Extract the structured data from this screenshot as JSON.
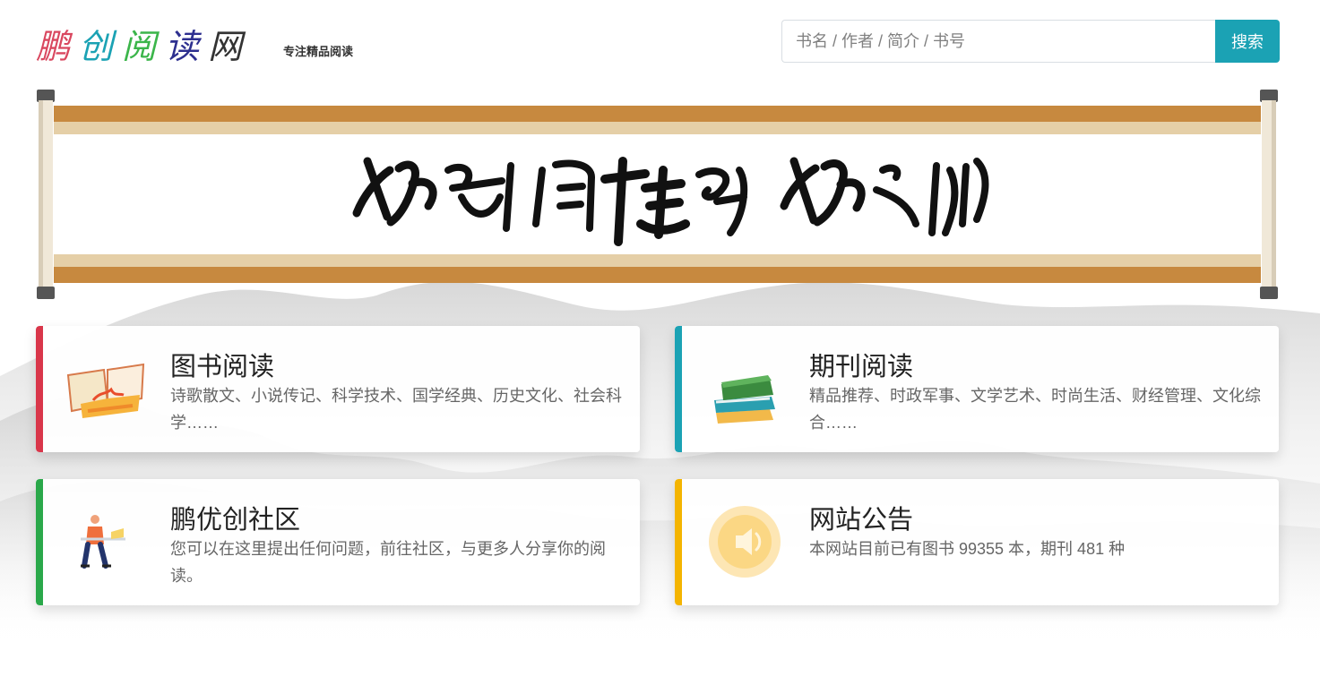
{
  "header": {
    "logo_chars": [
      {
        "char": "鹏",
        "color": "#d9475f"
      },
      {
        "char": "创",
        "color": "#1ba2b4"
      },
      {
        "char": "阅",
        "color": "#3bb54a"
      },
      {
        "char": "读",
        "color": "#2d2f8f"
      },
      {
        "char": "网",
        "color": "#333333"
      }
    ],
    "slogan": "专注精品阅读"
  },
  "search": {
    "placeholder": "书名 / 作者 / 简介 / 书号",
    "button_label": "搜索"
  },
  "banner": {
    "calligraphy_text": "鹏创阅读网 鹏之作"
  },
  "cards": [
    {
      "title": "图书阅读",
      "desc": "诗歌散文、小说传记、科学技术、国学经典、历史文化、社会科学……",
      "accent": "#d9364a",
      "icon": "open-book-icon"
    },
    {
      "title": "期刊阅读",
      "desc": "精品推荐、时政军事、文学艺术、时尚生活、财经管理、文化综合……",
      "accent": "#1ba2b4",
      "icon": "book-stack-icon"
    },
    {
      "title": "鹏优创社区",
      "desc": "您可以在这里提出任何问题，前往社区，与更多人分享你的阅读。",
      "accent": "#2aa84a",
      "icon": "community-person-icon"
    },
    {
      "title": "网站公告",
      "desc": "本网站目前已有图书 99355 本，期刊 481 种",
      "accent": "#f4b400",
      "icon": "speaker-icon"
    }
  ]
}
